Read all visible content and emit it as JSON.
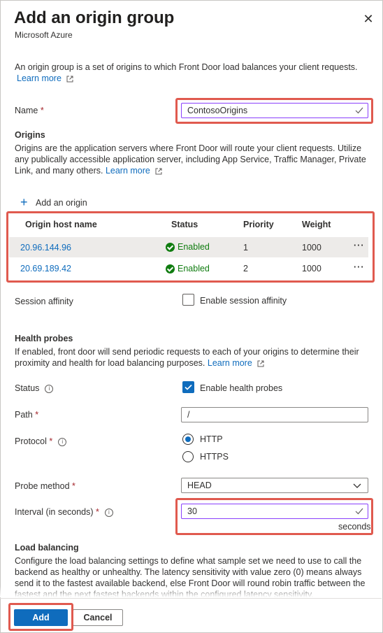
{
  "header": {
    "title": "Add an origin group",
    "subtitle": "Microsoft Azure",
    "close_icon": "close-icon"
  },
  "intro": {
    "text": "An origin group is a set of origins to which Front Door load balances your client requests.",
    "learn_more": "Learn more"
  },
  "name_field": {
    "label": "Name",
    "required_mark": "*",
    "value": "ContosoOrigins"
  },
  "origins": {
    "title": "Origins",
    "description": "Origins are the application servers where Front Door will route your client requests. Utilize any publically accessible application server, including App Service, Traffic Manager, Private Link, and many others.",
    "learn_more": "Learn more",
    "add_label": "Add an origin",
    "columns": [
      "Origin host name",
      "Status",
      "Priority",
      "Weight"
    ],
    "rows": [
      {
        "host": "20.96.144.96",
        "status": "Enabled",
        "priority": "1",
        "weight": "1000",
        "more": "···"
      },
      {
        "host": "20.69.189.42",
        "status": "Enabled",
        "priority": "2",
        "weight": "1000",
        "more": "···"
      }
    ]
  },
  "session_affinity": {
    "label": "Session affinity",
    "checkbox_label": "Enable session affinity",
    "checked": false
  },
  "health_probes": {
    "title": "Health probes",
    "description": "If enabled, front door will send periodic requests to each of your origins to determine their proximity and health for load balancing purposes.",
    "learn_more": "Learn more",
    "status_label": "Status",
    "status_checkbox_label": "Enable health probes",
    "status_checked": true,
    "path_label": "Path",
    "path_value": "/",
    "protocol_label": "Protocol",
    "protocol_options": [
      "HTTP",
      "HTTPS"
    ],
    "protocol_selected": "HTTP",
    "method_label": "Probe method",
    "method_value": "HEAD",
    "interval_label": "Interval (in seconds)",
    "interval_value": "30",
    "interval_unit": "seconds",
    "required_mark": "*"
  },
  "load_balancing": {
    "title": "Load balancing",
    "description": "Configure the load balancing settings to define what sample set we need to use to call the backend as healthy or unhealthy. The latency sensitivity with value zero (0) means always send it to the fastest available backend, else Front Door will round robin traffic between the fastest and the next fastest backends within the configured latency sensitivity."
  },
  "footer": {
    "add_label": "Add",
    "cancel_label": "Cancel"
  },
  "colors": {
    "accent": "#0f6cbd",
    "highlight": "#e05a4f",
    "success": "#107c10",
    "focus": "#8a3ffc"
  }
}
